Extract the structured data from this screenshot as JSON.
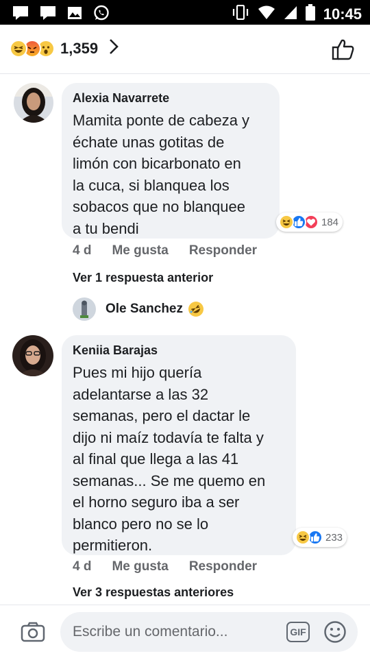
{
  "status_bar": {
    "time": "10:45",
    "left_icons": [
      "chat-icon",
      "chat-icon",
      "image-icon",
      "whatsapp-icon"
    ],
    "right_icons": [
      "vibrate-icon",
      "wifi-icon",
      "signal-icon",
      "battery-icon"
    ]
  },
  "header": {
    "reaction_icons": [
      "haha-icon",
      "angry-icon",
      "wow-icon"
    ],
    "reaction_count": "1,359"
  },
  "comments": [
    {
      "author": "Alexia Navarrete",
      "lines": [
        "Mamita ponte de cabeza y",
        "échate unas gotitas de",
        "limón con bicarbonato en",
        "la cuca, si blanquea los",
        "sobacos que no blanquee",
        "a tu bendi"
      ],
      "reaction_icons": [
        "haha-icon",
        "like-icon",
        "love-icon"
      ],
      "reaction_count": "184",
      "time": "4 d",
      "like_label": "Me gusta",
      "reply_label": "Responder",
      "view_replies": "Ver 1 respuesta anterior",
      "reply_preview": {
        "name": "Ole Sanchez",
        "emoji": "rofl-emoji"
      }
    },
    {
      "author": "Keniia Barajas",
      "lines": [
        "Pues mi hijo quería",
        "adelantarse a las 32",
        "semanas, pero el dactar le",
        "dijo ni maíz todavía te falta y",
        "al final que llega a las 41",
        "semanas... Se me quemo en",
        "el horno seguro iba a ser",
        "blanco pero no se lo",
        "permitieron."
      ],
      "reaction_icons": [
        "haha-icon",
        "like-icon"
      ],
      "reaction_count": "233",
      "time": "4 d",
      "like_label": "Me gusta",
      "reply_label": "Responder",
      "view_replies": "Ver 3 respuestas anteriores"
    }
  ],
  "composer": {
    "placeholder": "Escribe un comentario...",
    "gif_label": "GIF"
  },
  "colors": {
    "bubble": "#f0f2f5",
    "like_blue": "#1877f2",
    "love_red": "#f33e58",
    "haha_yellow": "#f7c844",
    "muted_text": "#65676b"
  }
}
